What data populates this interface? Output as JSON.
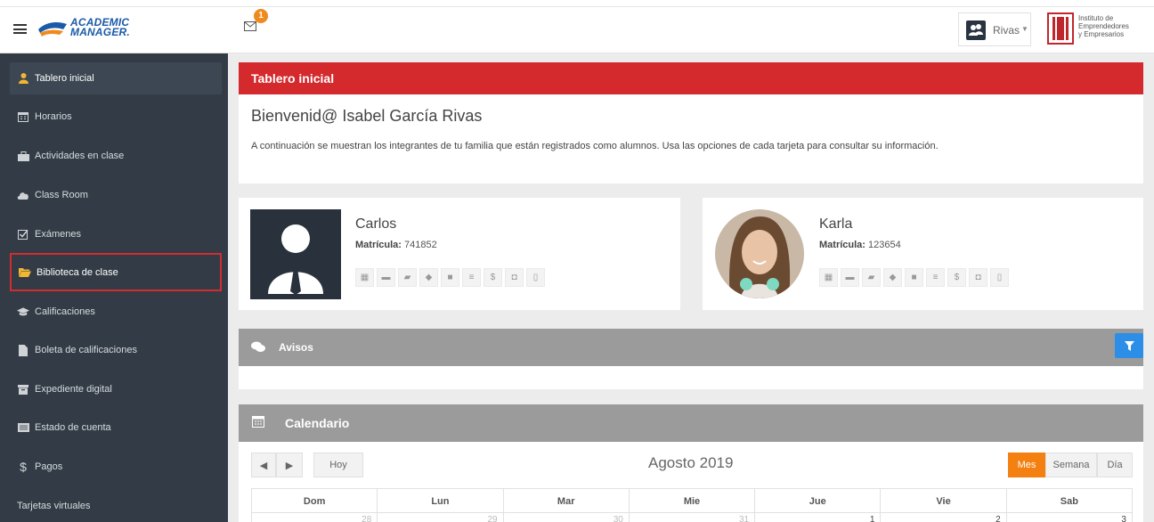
{
  "header": {
    "logo_line1": "ACADEMIC",
    "logo_line2": "MANAGER.",
    "mail_badge": "1",
    "user_name": "Rivas",
    "institution": [
      "Instituto de",
      "Emprendedores",
      "y Empresarios"
    ]
  },
  "sidebar": {
    "items": [
      {
        "label": "Tablero inicial",
        "icon": "user-icon"
      },
      {
        "label": "Horarios",
        "icon": "calendar-icon"
      },
      {
        "label": "Actividades en clase",
        "icon": "briefcase-icon"
      },
      {
        "label": "Class Room",
        "icon": "cloud-icon"
      },
      {
        "label": "Exámenes",
        "icon": "checkbox-icon"
      },
      {
        "label": "Biblioteca de clase",
        "icon": "folder-open-icon"
      },
      {
        "label": "Calificaciones",
        "icon": "graduation-cap-icon"
      },
      {
        "label": "Boleta de calificaciones",
        "icon": "file-icon"
      },
      {
        "label": "Expediente digital",
        "icon": "archive-icon"
      },
      {
        "label": "Estado de cuenta",
        "icon": "list-icon"
      },
      {
        "label": "Pagos",
        "icon": "dollar-icon"
      },
      {
        "label": "Tarjetas virtuales",
        "icon": ""
      }
    ]
  },
  "main": {
    "panel_title": "Tablero inicial",
    "welcome_title": "Bienvenid@ Isabel García Rivas",
    "welcome_desc": "A continuación se muestran los integrantes de tu familia que están registrados como alumnos. Usa las opciones de cada tarjeta para consultar su información.",
    "students": [
      {
        "name": "Carlos",
        "matricula_label": "Matrícula:",
        "matricula": "741852"
      },
      {
        "name": "Karla",
        "matricula_label": "Matrícula:",
        "matricula": "123654"
      }
    ],
    "card_icons": [
      "calendar-icon",
      "briefcase-icon",
      "folder-open-icon",
      "graduation-cap-icon",
      "archive-icon",
      "list-icon",
      "dollar-icon",
      "camera-icon",
      "document-icon"
    ],
    "avisos_title": "Avisos",
    "calendar": {
      "title": "Calendario",
      "today_label": "Hoy",
      "month_label": "Agosto 2019",
      "views": [
        "Mes",
        "Semana",
        "Día"
      ],
      "active_view": "Mes",
      "days": [
        "Dom",
        "Lun",
        "Mar",
        "Mie",
        "Jue",
        "Vie",
        "Sab"
      ],
      "first_row": [
        "28",
        "29",
        "30",
        "31",
        "1",
        "2",
        "3"
      ]
    }
  },
  "colors": {
    "sidebar_bg": "#333c46",
    "red_header": "#d4292d",
    "gray_bar": "#9b9b9b",
    "accent_orange": "#f48012",
    "filter_blue": "#2d8ee8"
  }
}
